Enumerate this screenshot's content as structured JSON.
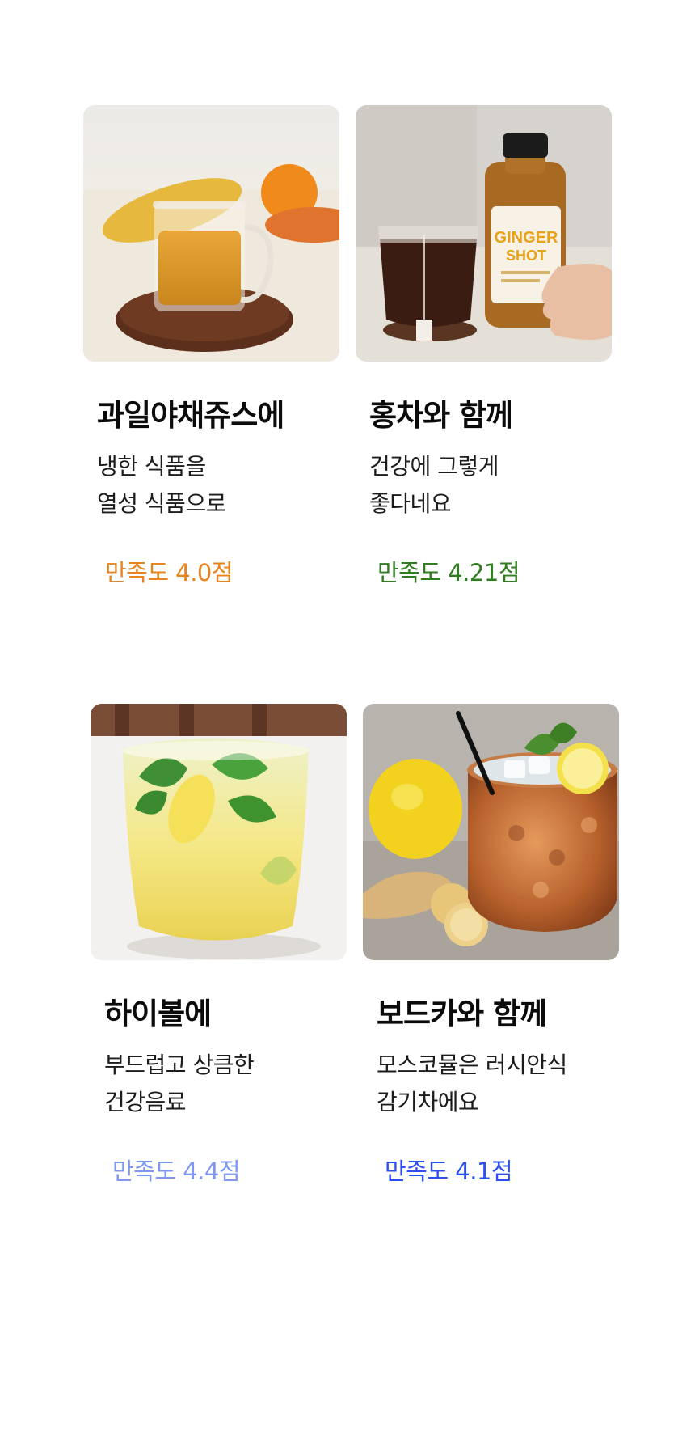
{
  "cards": [
    {
      "title": "과일야채쥬스에",
      "desc_line1": "냉한 식품을",
      "desc_line2": "열성 식품으로",
      "rating": "만족도 4.0점",
      "rating_color": "#e8841e",
      "image": "juice-glass-with-mango-photo"
    },
    {
      "title": "홍차와 함께",
      "desc_line1": "건강에 그렇게",
      "desc_line2": "좋다네요",
      "rating": "만족도 4.21점",
      "rating_color": "#2e7d1e",
      "image": "black-tea-and-ginger-shot-bottle-photo",
      "bottle_label_line1": "GINGER",
      "bottle_label_line2": "SHOT"
    },
    {
      "title": "하이볼에",
      "desc_line1": "부드럽고 상큼한",
      "desc_line2": "건강음료",
      "rating": "만족도 4.4점",
      "rating_color": "#7e97f0",
      "image": "highball-with-mint-and-lemon-photo"
    },
    {
      "title": "보드카와 함께",
      "desc_line1": "모스코뮬은 러시안식",
      "desc_line2": "감기차에요",
      "rating": "만족도 4.1점",
      "rating_color": "#2b4ef2",
      "image": "moscow-mule-copper-mug-photo"
    }
  ]
}
